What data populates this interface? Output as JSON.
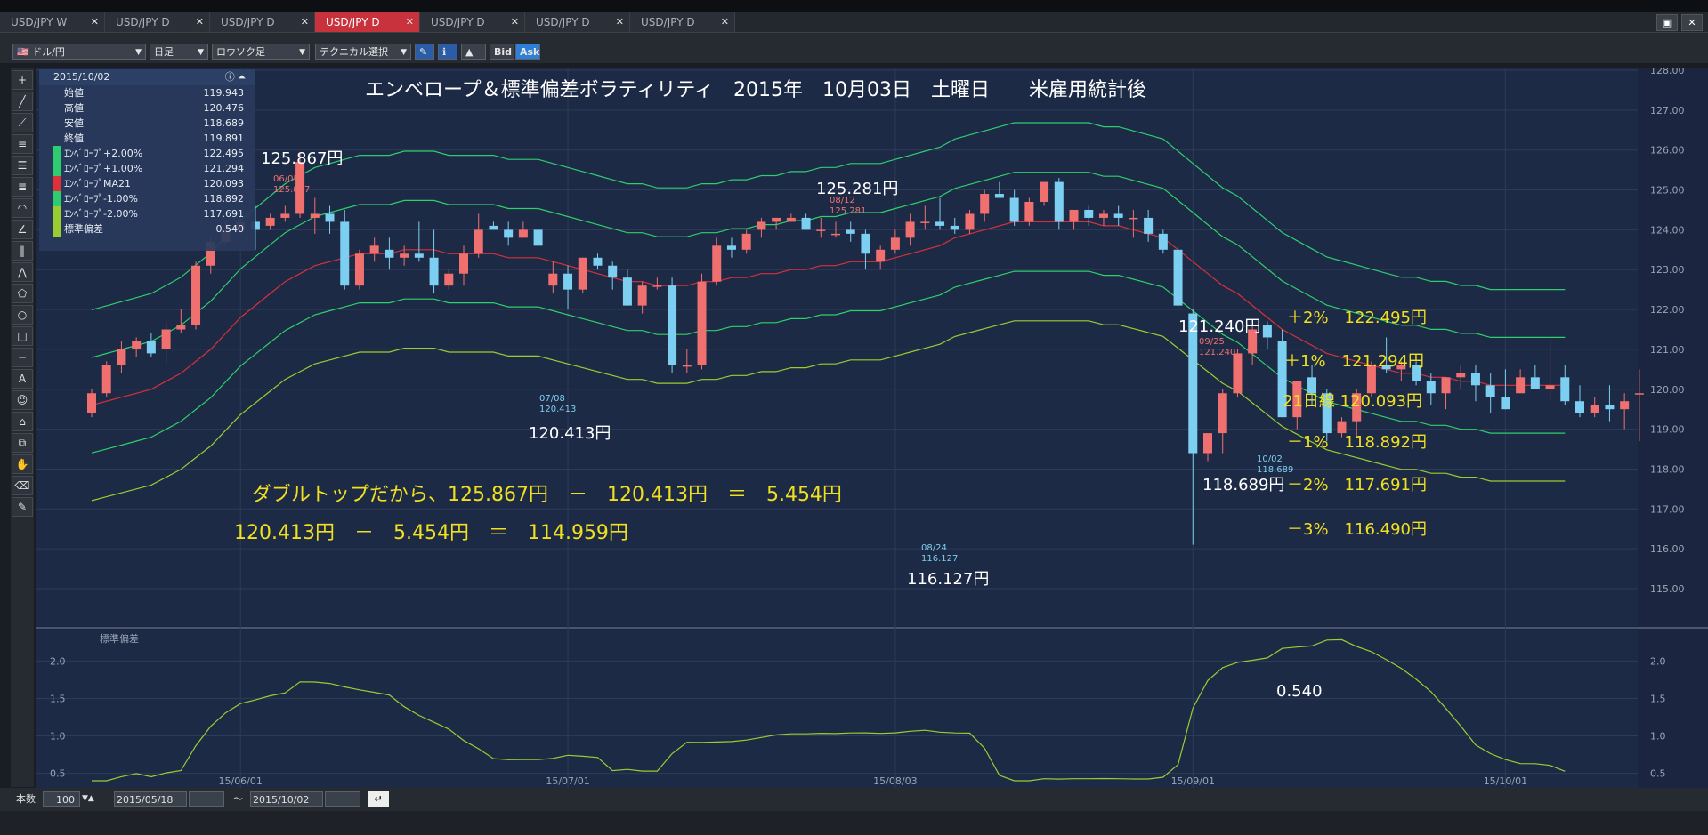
{
  "tabs": [
    {
      "label": "USD/JPY W",
      "active": false
    },
    {
      "label": "USD/JPY D",
      "active": false
    },
    {
      "label": "USD/JPY D",
      "active": false
    },
    {
      "label": "USD/JPY D",
      "active": true
    },
    {
      "label": "USD/JPY D",
      "active": false
    },
    {
      "label": "USD/JPY D",
      "active": false
    },
    {
      "label": "USD/JPY D",
      "active": false
    }
  ],
  "tab_close": "✕",
  "toolbar": {
    "symbol": "ドル/円",
    "timeframe": "日足",
    "chart_type": "ロウソク足",
    "technical": "テクニカル選択",
    "bid": "Bid",
    "ask": "Ask"
  },
  "info": {
    "date": "2015/10/02",
    "rows": [
      {
        "label": "始値",
        "value": "119.943",
        "color": "#e8ecf2"
      },
      {
        "label": "高値",
        "value": "120.476",
        "color": "#e8ecf2"
      },
      {
        "label": "安値",
        "value": "118.689",
        "color": "#e8ecf2"
      },
      {
        "label": "終値",
        "value": "119.891",
        "color": "#e8ecf2"
      },
      {
        "label": "ｴﾝﾍﾞﾛｰﾌﾟ+2.00%",
        "value": "122.495",
        "color": "#2ecc71"
      },
      {
        "label": "ｴﾝﾍﾞﾛｰﾌﾟ+1.00%",
        "value": "121.294",
        "color": "#2ecc71"
      },
      {
        "label": "ｴﾝﾍﾞﾛｰﾌﾟMA21",
        "value": "120.093",
        "color": "#e0303a"
      },
      {
        "label": "ｴﾝﾍﾞﾛｰﾌﾟ-1.00%",
        "value": "118.892",
        "color": "#2ecc71"
      },
      {
        "label": "ｴﾝﾍﾞﾛｰﾌﾟ-2.00%",
        "value": "117.691",
        "color": "#9acd32"
      },
      {
        "label": "標準偏差",
        "value": "0.540",
        "color": "#9acd32"
      }
    ]
  },
  "annotations": {
    "title": "エンベロープ＆標準偏差ボラティリティ　2015年　10月03日　土曜日　　米雇用統計後",
    "high1_big": "125.867円",
    "high1_date": "06/05",
    "high1_val": "125.867",
    "high2_big": "125.281円",
    "high2_date": "08/12",
    "high2_val": "125.281",
    "low1_big": "120.413円",
    "low1_date": "07/08",
    "low1_val": "120.413",
    "low2_big": "116.127円",
    "low2_date": "08/24",
    "low2_val": "116.127",
    "high3_big": "121.240円",
    "high3_date": "09/25",
    "high3_val": "121.240",
    "last_big": "118.689円",
    "last_date": "10/02",
    "last_val": "118.689",
    "calc1": "ダブルトップだから、125.867円　－　120.413円　＝　5.454円",
    "calc2": "120.413円　－　5.454円　＝　114.959円",
    "band_p2": "＋2%　122.495円",
    "band_p1": "＋1%　121.294円",
    "band_ma": "21日線 120.093円",
    "band_m1": "－1%　118.892円",
    "band_m2": "－2%　117.691円",
    "band_m3": "－3%　116.490円",
    "std_last": "0.540",
    "sub_label": "標準偏差"
  },
  "bottom": {
    "count_label": "本数",
    "count": "100",
    "from": "2015/05/18",
    "tilde": "～",
    "to": "2015/10/02"
  },
  "colors": {
    "bg": "#1d2a45",
    "up": "#f07070",
    "down": "#7ccff0",
    "ma": "#d8303a",
    "env1": "#2ecc71",
    "env2": "#2fcf6a",
    "env3": "#9acd32",
    "std": "#9acd32",
    "yellow": "#f0e020"
  },
  "chart_data": {
    "type": "candlestick",
    "ylim": [
      115,
      128
    ],
    "sub_ylim": [
      0.4,
      2.35
    ],
    "yticks": [
      "128.00",
      "127.00",
      "126.00",
      "125.00",
      "124.00",
      "123.00",
      "122.00",
      "121.00",
      "120.00",
      "119.00",
      "118.00",
      "117.00",
      "116.00",
      "115.00"
    ],
    "sub_yticks": [
      "2.0",
      "1.5",
      "1.0",
      "0.5"
    ],
    "xticks": [
      {
        "i": 10,
        "label": "15/06/01"
      },
      {
        "i": 32,
        "label": "15/07/01"
      },
      {
        "i": 54,
        "label": "15/08/03"
      },
      {
        "i": 74,
        "label": "15/09/01"
      },
      {
        "i": 95,
        "label": "15/10/01"
      }
    ],
    "candles": [
      [
        119.4,
        120.0,
        119.3,
        119.9
      ],
      [
        119.9,
        120.7,
        119.8,
        120.6
      ],
      [
        120.6,
        121.2,
        120.4,
        121.0
      ],
      [
        121.0,
        121.3,
        120.8,
        121.2
      ],
      [
        121.2,
        121.4,
        120.8,
        120.9
      ],
      [
        121.0,
        121.7,
        120.6,
        121.5
      ],
      [
        121.5,
        122.0,
        121.4,
        121.6
      ],
      [
        121.6,
        123.2,
        121.5,
        123.1
      ],
      [
        123.1,
        123.8,
        122.9,
        123.7
      ],
      [
        123.7,
        124.2,
        123.6,
        124.0
      ],
      [
        124.0,
        124.4,
        123.9,
        124.2
      ],
      [
        124.2,
        124.6,
        123.5,
        124.0
      ],
      [
        124.1,
        124.4,
        124.0,
        124.3
      ],
      [
        124.3,
        124.6,
        124.2,
        124.4
      ],
      [
        124.4,
        125.9,
        124.3,
        125.7
      ],
      [
        124.3,
        124.8,
        123.9,
        124.4
      ],
      [
        124.4,
        124.6,
        123.9,
        124.2
      ],
      [
        124.2,
        124.5,
        122.5,
        122.6
      ],
      [
        122.6,
        123.5,
        122.5,
        123.4
      ],
      [
        123.4,
        123.8,
        123.2,
        123.6
      ],
      [
        123.5,
        123.8,
        123.0,
        123.3
      ],
      [
        123.3,
        123.6,
        123.1,
        123.4
      ],
      [
        123.4,
        124.2,
        123.2,
        123.3
      ],
      [
        123.3,
        124.0,
        122.4,
        122.6
      ],
      [
        122.6,
        123.0,
        122.5,
        122.9
      ],
      [
        122.9,
        123.6,
        122.6,
        123.4
      ],
      [
        123.4,
        124.4,
        123.3,
        124.0
      ],
      [
        124.1,
        124.2,
        124.0,
        124.0
      ],
      [
        124.0,
        124.2,
        123.6,
        123.8
      ],
      [
        123.8,
        124.2,
        123.8,
        124.0
      ],
      [
        124.0,
        124.0,
        123.8,
        123.6
      ],
      [
        122.6,
        123.2,
        122.4,
        122.9
      ],
      [
        122.9,
        123.1,
        122.0,
        122.5
      ],
      [
        122.5,
        123.3,
        122.4,
        123.3
      ],
      [
        123.3,
        123.4,
        123.0,
        123.1
      ],
      [
        123.1,
        123.2,
        122.5,
        122.8
      ],
      [
        122.8,
        123.0,
        122.1,
        122.1
      ],
      [
        122.1,
        122.7,
        121.9,
        122.6
      ],
      [
        122.6,
        122.8,
        122.5,
        122.6
      ],
      [
        122.6,
        122.8,
        120.4,
        120.6
      ],
      [
        120.6,
        121.0,
        120.4,
        120.6
      ],
      [
        120.6,
        122.9,
        120.5,
        122.7
      ],
      [
        122.7,
        123.8,
        122.6,
        123.6
      ],
      [
        123.6,
        123.8,
        123.3,
        123.5
      ],
      [
        123.5,
        124.0,
        123.4,
        123.9
      ],
      [
        124.0,
        124.3,
        123.8,
        124.2
      ],
      [
        124.2,
        124.3,
        124.0,
        124.3
      ],
      [
        124.2,
        124.4,
        124.2,
        124.3
      ],
      [
        124.3,
        124.4,
        124.0,
        124.0
      ],
      [
        124.0,
        124.3,
        123.8,
        124.0
      ],
      [
        123.9,
        124.2,
        123.8,
        123.9
      ],
      [
        124.0,
        124.2,
        123.7,
        123.9
      ],
      [
        123.9,
        124.0,
        123.0,
        123.4
      ],
      [
        123.2,
        123.6,
        123.0,
        123.5
      ],
      [
        123.5,
        124.0,
        123.4,
        123.8
      ],
      [
        123.8,
        124.4,
        123.6,
        124.2
      ],
      [
        124.2,
        124.6,
        124.0,
        124.2
      ],
      [
        124.2,
        124.8,
        124.0,
        124.1
      ],
      [
        124.1,
        124.3,
        123.9,
        124.0
      ],
      [
        124.0,
        124.5,
        123.9,
        124.4
      ],
      [
        124.4,
        125.0,
        124.2,
        124.9
      ],
      [
        124.9,
        125.2,
        124.9,
        124.8
      ],
      [
        124.8,
        125.0,
        124.1,
        124.2
      ],
      [
        124.2,
        124.8,
        124.1,
        124.7
      ],
      [
        124.7,
        125.2,
        124.6,
        125.2
      ],
      [
        125.2,
        125.3,
        124.0,
        124.2
      ],
      [
        124.2,
        124.5,
        124.0,
        124.5
      ],
      [
        124.5,
        124.6,
        124.1,
        124.3
      ],
      [
        124.3,
        124.5,
        124.1,
        124.4
      ],
      [
        124.4,
        124.6,
        124.1,
        124.3
      ],
      [
        124.3,
        124.5,
        123.8,
        124.3
      ],
      [
        124.3,
        124.5,
        123.7,
        123.9
      ],
      [
        123.9,
        124.0,
        123.4,
        123.5
      ],
      [
        123.5,
        123.6,
        122.0,
        122.1
      ],
      [
        121.9,
        122.0,
        116.1,
        118.4
      ],
      [
        118.4,
        118.9,
        118.2,
        118.9
      ],
      [
        118.9,
        120.0,
        118.4,
        119.9
      ],
      [
        119.9,
        121.0,
        119.8,
        120.9
      ],
      [
        120.9,
        121.6,
        120.6,
        121.5
      ],
      [
        121.6,
        121.7,
        121.0,
        121.3
      ],
      [
        121.2,
        121.5,
        119.3,
        119.3
      ],
      [
        119.3,
        119.8,
        119.0,
        120.2
      ],
      [
        120.3,
        120.6,
        119.6,
        119.9
      ],
      [
        119.9,
        120.0,
        118.7,
        118.9
      ],
      [
        118.9,
        119.3,
        118.8,
        119.2
      ],
      [
        119.2,
        120.0,
        118.8,
        119.9
      ],
      [
        119.9,
        120.7,
        119.8,
        120.6
      ],
      [
        120.6,
        121.3,
        120.4,
        120.5
      ],
      [
        120.5,
        120.7,
        120.2,
        120.6
      ],
      [
        120.6,
        120.7,
        120.1,
        120.2
      ],
      [
        120.2,
        120.4,
        119.6,
        119.9
      ],
      [
        119.9,
        120.3,
        119.5,
        120.3
      ],
      [
        120.3,
        120.6,
        120.0,
        120.4
      ],
      [
        120.4,
        120.6,
        119.7,
        120.1
      ],
      [
        120.1,
        120.4,
        119.4,
        119.8
      ],
      [
        119.8,
        120.5,
        119.5,
        119.5
      ],
      [
        119.9,
        120.5,
        119.9,
        120.3
      ],
      [
        120.3,
        120.6,
        120.0,
        120.0
      ],
      [
        120.0,
        121.3,
        119.7,
        120.1
      ],
      [
        120.3,
        120.6,
        119.6,
        119.7
      ],
      [
        119.7,
        120.1,
        119.3,
        119.4
      ],
      [
        119.4,
        119.8,
        119.3,
        119.6
      ],
      [
        119.6,
        120.1,
        119.2,
        119.5
      ],
      [
        119.5,
        119.9,
        119.0,
        119.7
      ],
      [
        119.9,
        120.5,
        118.7,
        119.9
      ]
    ],
    "ma21": [
      119.6,
      119.7,
      119.8,
      119.9,
      120.0,
      120.2,
      120.4,
      120.7,
      121.0,
      121.4,
      121.8,
      122.1,
      122.4,
      122.7,
      122.9,
      123.1,
      123.2,
      123.3,
      123.4,
      123.4,
      123.4,
      123.5,
      123.5,
      123.5,
      123.4,
      123.4,
      123.4,
      123.4,
      123.3,
      123.3,
      123.3,
      123.2,
      123.1,
      123.0,
      122.9,
      122.8,
      122.7,
      122.7,
      122.6,
      122.6,
      122.6,
      122.7,
      122.7,
      122.8,
      122.8,
      122.9,
      122.9,
      123.0,
      123.0,
      123.1,
      123.1,
      123.2,
      123.2,
      123.2,
      123.3,
      123.4,
      123.5,
      123.6,
      123.8,
      123.9,
      124.0,
      124.1,
      124.2,
      124.2,
      124.2,
      124.2,
      124.2,
      124.2,
      124.1,
      124.1,
      124.0,
      123.9,
      123.8,
      123.5,
      123.2,
      122.9,
      122.6,
      122.4,
      122.1,
      121.8,
      121.5,
      121.3,
      121.1,
      120.9,
      120.8,
      120.7,
      120.6,
      120.5,
      120.4,
      120.4,
      120.3,
      120.3,
      120.2,
      120.2,
      120.1,
      120.1,
      120.1,
      120.1,
      120.1,
      120.1
    ]
  }
}
